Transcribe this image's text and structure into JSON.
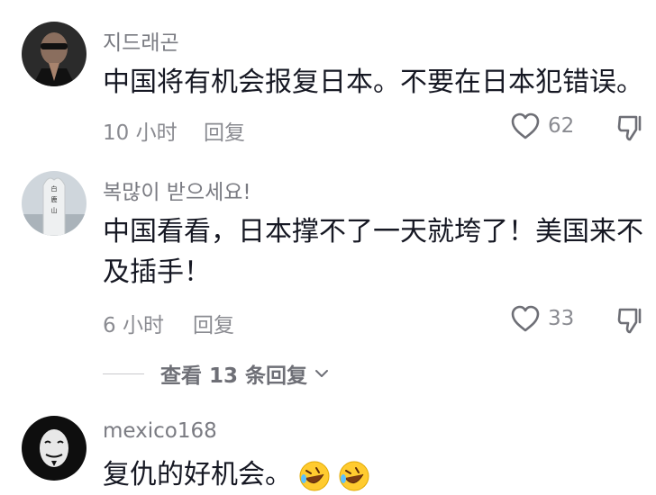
{
  "comments": [
    {
      "username": "지드래곤",
      "text": "中国将有机会报复日本。不要在日本犯错误。",
      "time": "10 小时",
      "reply_label": "回复",
      "likes": "62",
      "avatar_icon": "man-praying-hands-avatar"
    },
    {
      "username": "복많이 받으세요!",
      "text_line1": "中国看看，日本撑不了一天就垮了！美国来不",
      "text_line2": "及插手！",
      "time": "6 小时",
      "reply_label": "回复",
      "likes": "33",
      "avatar_icon": "stone-monument-avatar",
      "avatar_inscription": "白 鹿 山"
    },
    {
      "username": "mexico168",
      "text": "复仇的好机会。",
      "avatar_icon": "guy-fawkes-mask-avatar",
      "emojis": [
        "rolling-on-floor-laughing-emoji",
        "rolling-on-floor-laughing-emoji"
      ]
    }
  ],
  "view_replies": {
    "label": "查看 13 条回复"
  },
  "colors": {
    "text": "#161823",
    "muted": "#8a8b91",
    "username": "#7a7b82"
  }
}
